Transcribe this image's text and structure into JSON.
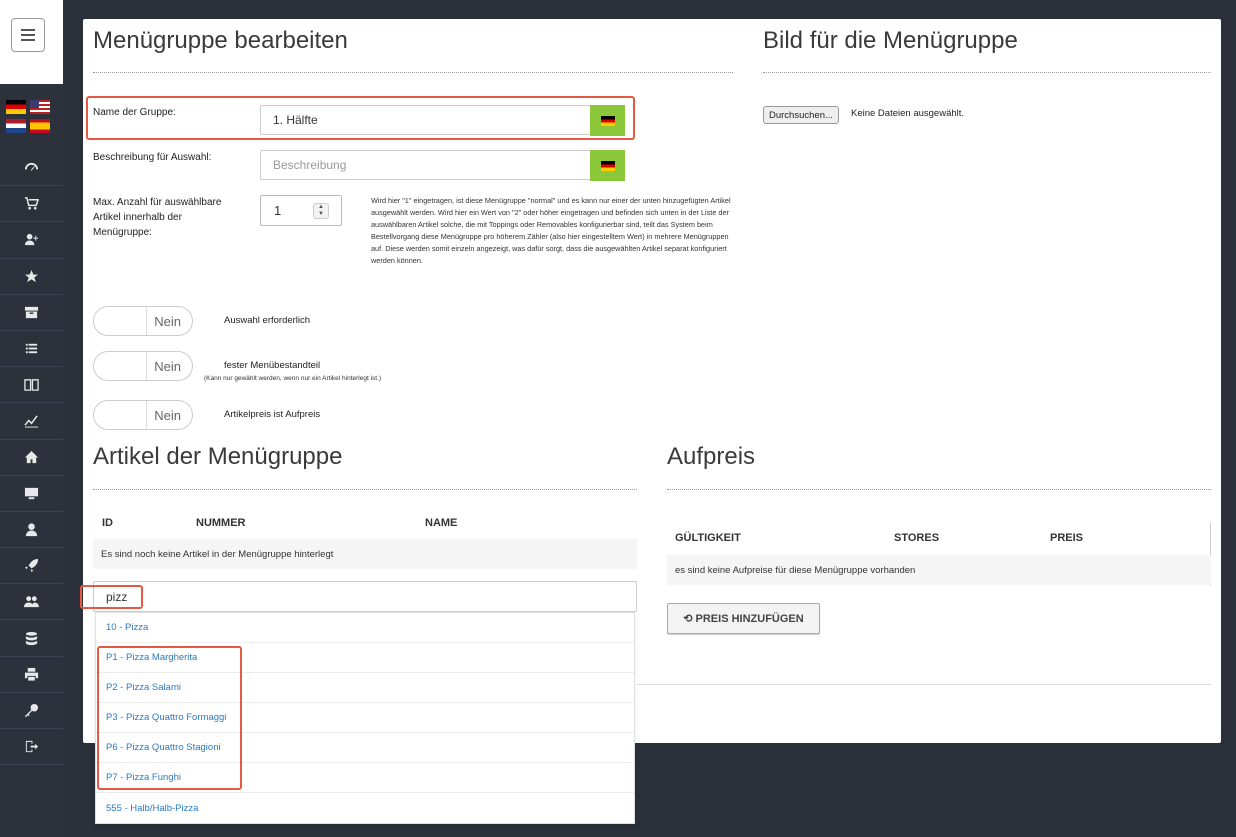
{
  "sidebar": {
    "flags": [
      "de",
      "us",
      "nl",
      "es"
    ],
    "icons": [
      "gauge-icon",
      "cart-icon",
      "add-user-icon",
      "star-icon",
      "archive-icon",
      "list-icon",
      "book-icon",
      "chart-icon",
      "home-icon",
      "monitor-icon",
      "user-icon",
      "rocket-icon",
      "users-icon",
      "database-icon",
      "printer-icon",
      "key-icon",
      "logout-icon"
    ]
  },
  "edit": {
    "title": "Menügruppe bearbeiten",
    "name_label": "Name der Gruppe:",
    "name_value": "1. Hälfte",
    "desc_label": "Beschreibung für Auswahl:",
    "desc_placeholder": "Beschreibung",
    "max_label": "Max. Anzahl für auswählbare Artikel innerhalb der Menügruppe:",
    "max_value": "1",
    "help_text": "Wird hier \"1\" eingetragen, ist diese Menügruppe \"normal\" und es kann nur einer der unten hinzugefügten Artikel ausgewählt werden. Wird hier ein Wert von \"2\" oder höher eingetragen und befinden sich unten in der Liste der auswählbaren Artikel solche, die mit Toppings oder Removables konfigurierbar sind, teilt das System beim Bestellvorgang diese Menügruppe pro höherem Zähler (also hier eingestelltem Wert) in mehrere Menügruppen auf. Diese werden somit einzeln angezeigt, was dafür sorgt, dass die ausgewählten Artikel separat konfiguriert werden können."
  },
  "toggles": [
    {
      "state": "Nein",
      "label": "Auswahl erforderlich"
    },
    {
      "state": "Nein",
      "label": "fester Menübestandteil"
    },
    {
      "state": "Nein",
      "label": "Artikelpreis ist Aufpreis"
    }
  ],
  "toggle_note": "(Kann nur gewählt werden, wenn nur ein Artikel hinterlegt ist.)",
  "image": {
    "title": "Bild für die Menügruppe",
    "browse_label": "Durchsuchen...",
    "no_file": "Keine Dateien ausgewählt."
  },
  "articles": {
    "title": "Artikel der Menügruppe",
    "columns": [
      "ID",
      "NUMMER",
      "NAME"
    ],
    "empty": "Es sind noch keine Artikel in der Menügruppe hinterlegt",
    "search_value": "pizz",
    "suggestions": [
      "10 - Pizza",
      "P1 - Pizza Margherita",
      "P2 - Pizza Salami",
      "P3 - Pizza Quattro Formaggi",
      "P6 - Pizza Quattro Stagioni",
      "P7 - Pizza Funghi",
      "555 - Halb/Halb-Pizza"
    ]
  },
  "aufpreis": {
    "title": "Aufpreis",
    "columns": [
      "GÜLTIGKEIT",
      "STORES",
      "PREIS"
    ],
    "empty": "es sind keine Aufpreise für diese Menügruppe vorhanden",
    "button": "PREIS HINZUFÜGEN"
  }
}
